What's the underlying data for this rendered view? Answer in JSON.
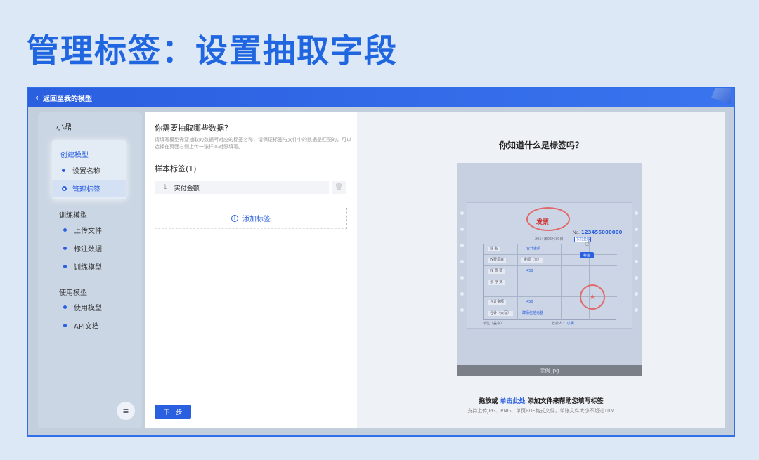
{
  "headline": "管理标签：设置抽取字段",
  "topbar": {
    "back_label": "返回至我的模型"
  },
  "sidebar": {
    "title": "小鼎",
    "create_group": {
      "title": "创建模型",
      "items": [
        {
          "label": "设置名称"
        },
        {
          "label": "管理标签"
        }
      ]
    },
    "train_section": {
      "title": "训练模型",
      "items": [
        {
          "label": "上传文件"
        },
        {
          "label": "标注数据"
        },
        {
          "label": "训练模型"
        }
      ]
    },
    "use_section": {
      "title": "使用模型",
      "items": [
        {
          "label": "使用模型"
        },
        {
          "label": "API文档"
        }
      ]
    },
    "collapse_icon": "≡"
  },
  "form": {
    "question": "你需要抽取哪些数据？",
    "description": "请填写模型需要抽取的数据所对应的标签名称，请保证标签与文件中的数据是匹配的，可以选择在页面右侧上传一张样本对照填写。",
    "tags_heading": "样本标签(1)",
    "tags": [
      {
        "num": "1",
        "value": "实付金额"
      }
    ],
    "add_tag": "添加标签",
    "next": "下一步"
  },
  "preview": {
    "title": "你知道什么是标签吗？",
    "sample_caption": "示例.jpg",
    "invoice": {
      "title": "发票",
      "no_label": "No.",
      "no_value": "123456000000",
      "date": "2014年06月30日",
      "tag_bubble": "标签",
      "pick": "实付金额",
      "cells": [
        "姓 名",
        "合计金额",
        "收费项目",
        "金额（元）",
        "收 费 费",
        "450",
        "诊 疗 费",
        "合计金额",
        "450",
        "合计（大写）",
        "肆佰伍拾元整",
        "单位（盖章）",
        "收款人：",
        "小明"
      ]
    },
    "drop_prefix": "拖放或",
    "drop_link": "单击此处",
    "drop_suffix": "添加文件来帮助您填写标签",
    "support": "支持上传JPG、PNG、单页PDF格式文件，单张文件大小不超过10M"
  }
}
